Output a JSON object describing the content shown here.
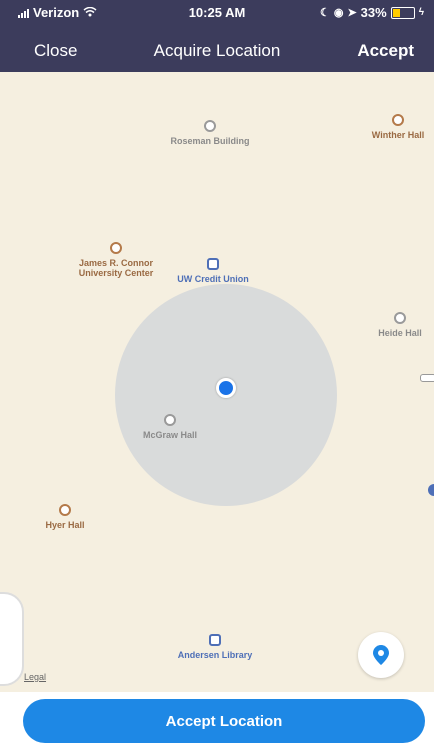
{
  "status_bar": {
    "carrier": "Verizon",
    "time": "10:25 AM",
    "battery": "33%"
  },
  "nav": {
    "close_label": "Close",
    "title": "Acquire Location",
    "accept_label": "Accept"
  },
  "map": {
    "pois": [
      {
        "name": "Roseman Building",
        "style": "gray"
      },
      {
        "name": "Winther Hall",
        "style": "brown"
      },
      {
        "name": "James R. Connor University Center",
        "style": "brown"
      },
      {
        "name": "UW Credit Union",
        "style": "blue"
      },
      {
        "name": "Heide Hall",
        "style": "gray"
      },
      {
        "name": "McGraw Hall",
        "style": "gray"
      },
      {
        "name": "Hyer Hall",
        "style": "brown"
      },
      {
        "name": "Andersen Library",
        "style": "blue"
      }
    ],
    "legal": "Legal"
  },
  "bottom": {
    "accept_location_label": "Accept Location"
  },
  "colors": {
    "nav_bg": "#3c3c5c",
    "accent": "#1e88e5",
    "map_bg": "#f5efe0"
  }
}
